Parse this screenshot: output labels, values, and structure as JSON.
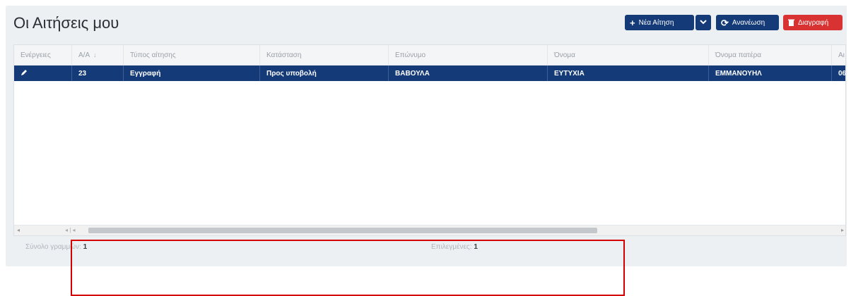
{
  "page": {
    "title": "Οι Αιτήσεις μου"
  },
  "toolbar": {
    "new_label": "Νέα Αίτηση",
    "refresh_label": "Ανανέωση",
    "delete_label": "Διαγραφή",
    "new_icon": "plus-icon",
    "dropdown_icon": "chevron-down-icon",
    "refresh_icon": "refresh-icon",
    "delete_icon": "trash-icon"
  },
  "grid": {
    "columns": [
      "Ενέργειες",
      "Α/Α",
      "Τύπος αίτησης",
      "Κατάσταση",
      "Επώνυμο",
      "Όνομα",
      "Όνομα πατέρα",
      "Αι"
    ],
    "sort_indicator": "↓",
    "rows": [
      {
        "action_icon": "pencil-icon",
        "cells": [
          "23",
          "Εγγραφή",
          "Προς υποβολή",
          "ΒΑΒΟΥΛΑ",
          "ΕΥΤΥΧΙΑ",
          "ΕΜΜΑΝΟΥΗΛ",
          "06"
        ]
      }
    ],
    "selected_row_color": "#143a78"
  },
  "footer": {
    "total_label": "Σύνολο γραμμών:",
    "total_value": "1",
    "selected_label": "Επιλεγμένες:",
    "selected_value": "1"
  },
  "colors": {
    "primary": "#143a78",
    "danger": "#d83232",
    "highlight": "#d40000"
  }
}
